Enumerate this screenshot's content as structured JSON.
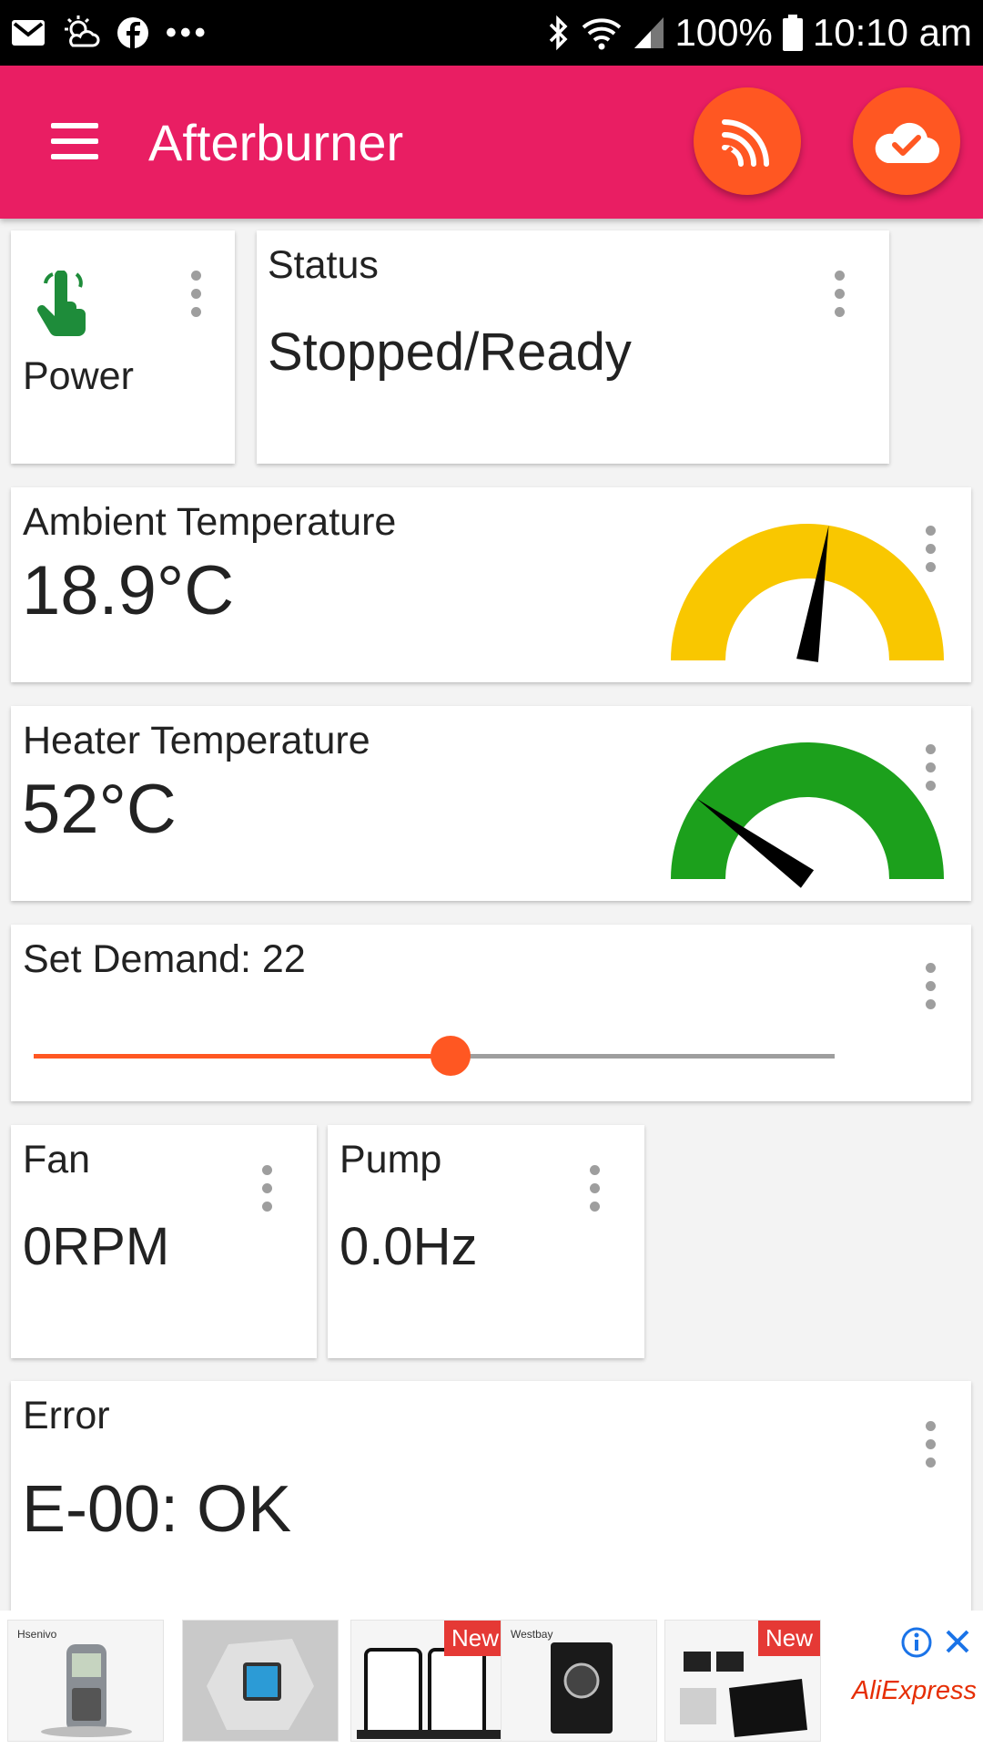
{
  "status_bar": {
    "battery": "100%",
    "time": "10:10 am",
    "overflow": "•••",
    "icons": [
      "gmail-icon",
      "weather-icon",
      "facebook-icon",
      "bluetooth-icon",
      "wifi-icon",
      "signal-icon",
      "battery-icon"
    ]
  },
  "app_bar": {
    "title": "Afterburner",
    "actions": [
      "wifi-signal-icon",
      "cloud-check-icon"
    ]
  },
  "power_card": {
    "label": "Power",
    "icon": "touch-hand-icon",
    "icon_color": "#1e8c3a"
  },
  "status_card": {
    "title": "Status",
    "value": "Stopped/Ready"
  },
  "ambient_card": {
    "title": "Ambient Temperature",
    "value": "18.9°C",
    "gauge_color": "#f9c700",
    "gauge_level": 0.55
  },
  "heater_card": {
    "title": "Heater Temperature",
    "value": "52°C",
    "gauge_color": "#1ca01c",
    "gauge_level": 0.2
  },
  "demand_card": {
    "title": "Set Demand: 22",
    "value": 22,
    "level": 0.52
  },
  "fan_card": {
    "title": "Fan",
    "value": "0RPM"
  },
  "pump_card": {
    "title": "Pump",
    "value": "0.0Hz"
  },
  "error_card": {
    "title": "Error",
    "value": "E-00: OK"
  },
  "ads": {
    "items": [
      {
        "brand": "Hsenivo",
        "badge": ""
      },
      {
        "brand": "",
        "badge": ""
      },
      {
        "brand": "",
        "badge": "New"
      },
      {
        "brand": "Westbay",
        "badge": ""
      },
      {
        "brand": "",
        "badge": "New"
      }
    ],
    "advertiser": "AliExpress",
    "colors": {
      "badge": "#e53935",
      "brand": "#e62e04",
      "info": "#1a73e8"
    }
  },
  "colors": {
    "app_bar": "#e91e63",
    "accent": "#ff5722",
    "status_bar": "#000000",
    "background": "#f3f3f3"
  }
}
